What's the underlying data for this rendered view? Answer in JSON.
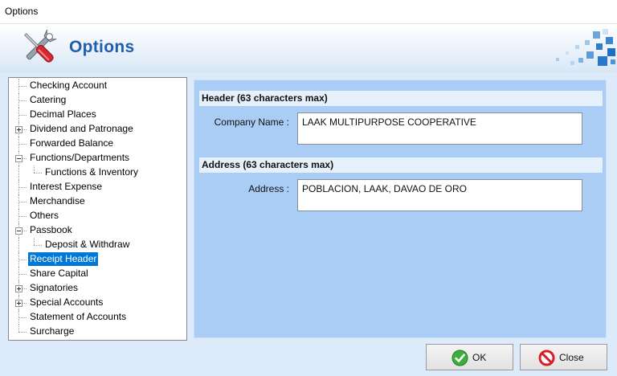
{
  "window": {
    "title": "Options"
  },
  "header": {
    "title": "Options",
    "icon": "tools-wrench-screwdriver-icon"
  },
  "tree": {
    "items": [
      {
        "label": "Checking Account",
        "level": 0,
        "expander": "none",
        "selected": false
      },
      {
        "label": "Catering",
        "level": 0,
        "expander": "none",
        "selected": false
      },
      {
        "label": "Decimal Places",
        "level": 0,
        "expander": "none",
        "selected": false
      },
      {
        "label": "Dividend and Patronage",
        "level": 0,
        "expander": "plus",
        "selected": false
      },
      {
        "label": "Forwarded Balance",
        "level": 0,
        "expander": "none",
        "selected": false
      },
      {
        "label": "Functions/Departments",
        "level": 0,
        "expander": "minus",
        "selected": false
      },
      {
        "label": "Functions & Inventory",
        "level": 1,
        "expander": "none",
        "selected": false
      },
      {
        "label": "Interest Expense",
        "level": 0,
        "expander": "none",
        "selected": false
      },
      {
        "label": "Merchandise",
        "level": 0,
        "expander": "none",
        "selected": false
      },
      {
        "label": "Others",
        "level": 0,
        "expander": "none",
        "selected": false
      },
      {
        "label": "Passbook",
        "level": 0,
        "expander": "minus",
        "selected": false
      },
      {
        "label": "Deposit & Withdraw",
        "level": 1,
        "expander": "none",
        "selected": false
      },
      {
        "label": "Receipt Header",
        "level": 0,
        "expander": "none",
        "selected": true
      },
      {
        "label": "Share Capital",
        "level": 0,
        "expander": "none",
        "selected": false
      },
      {
        "label": "Signatories",
        "level": 0,
        "expander": "plus",
        "selected": false
      },
      {
        "label": "Special Accounts",
        "level": 0,
        "expander": "plus",
        "selected": false
      },
      {
        "label": "Statement of Accounts",
        "level": 0,
        "expander": "none",
        "selected": false
      },
      {
        "label": "Surcharge",
        "level": 0,
        "expander": "none",
        "selected": false
      }
    ]
  },
  "panel": {
    "header_section": {
      "title": "Header (63 characters max)",
      "field_label": "Company Name :",
      "field_value": "LAAK MULTIPURPOSE COOPERATIVE"
    },
    "address_section": {
      "title": "Address (63 characters max)",
      "field_label": "Address :",
      "field_value": "POBLACION, LAAK, DAVAO DE ORO"
    }
  },
  "buttons": {
    "ok": {
      "label": "OK",
      "icon": "check-circle-icon"
    },
    "close": {
      "label": "Close",
      "icon": "no-entry-icon"
    }
  },
  "colors": {
    "header_title": "#1f5fae",
    "panel_bg": "#a9cdf5",
    "section_bg": "#e6f0fb",
    "selection": "#0078d7",
    "ok_green": "#3cae3c",
    "close_red": "#d61f26"
  }
}
